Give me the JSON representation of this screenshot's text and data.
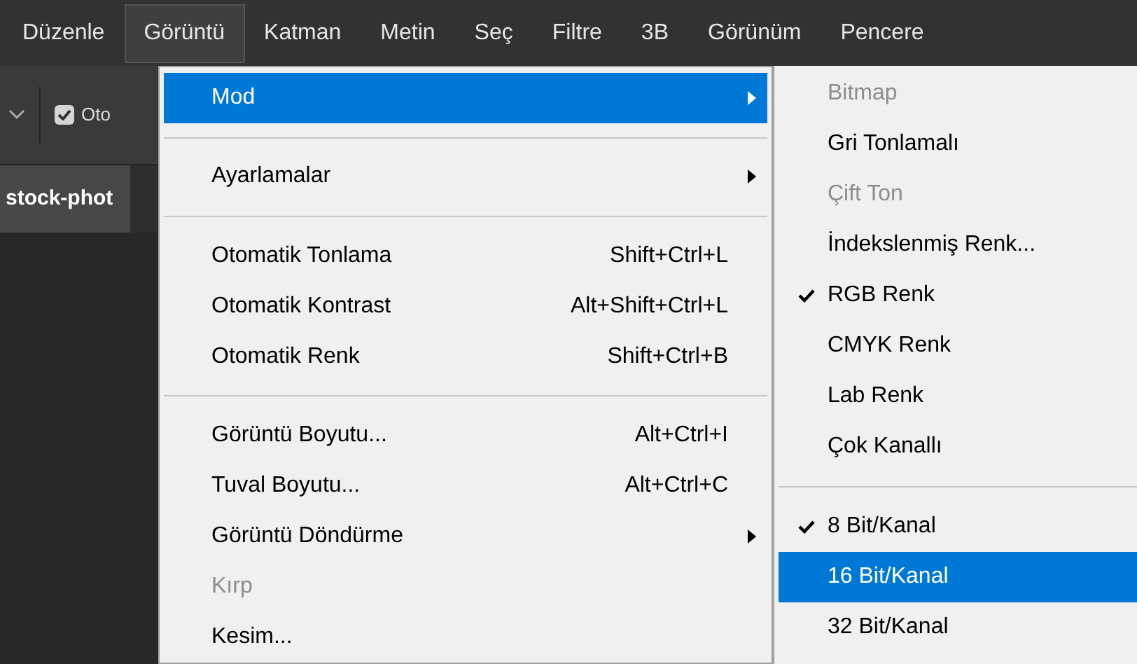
{
  "menubar": [
    {
      "label": "Düzenle",
      "selected": false
    },
    {
      "label": "Görüntü",
      "selected": true
    },
    {
      "label": "Katman",
      "selected": false
    },
    {
      "label": "Metin",
      "selected": false
    },
    {
      "label": "Seç",
      "selected": false
    },
    {
      "label": "Filtre",
      "selected": false
    },
    {
      "label": "3B",
      "selected": false
    },
    {
      "label": "Görünüm",
      "selected": false
    },
    {
      "label": "Pencere",
      "selected": false
    }
  ],
  "options_bar": {
    "checkbox": {
      "label": "Oto",
      "checked": true
    }
  },
  "document_tab": {
    "label": "stock-phot"
  },
  "menu": [
    {
      "kind": "item",
      "label": "Mod",
      "submenu": true,
      "selected": true,
      "disabled": false
    },
    {
      "kind": "separator"
    },
    {
      "kind": "item",
      "label": "Ayarlamalar",
      "submenu": true,
      "selected": false,
      "disabled": false
    },
    {
      "kind": "separator"
    },
    {
      "kind": "item",
      "label": "Otomatik Tonlama",
      "shortcut": "Shift+Ctrl+L",
      "submenu": false,
      "selected": false,
      "disabled": false
    },
    {
      "kind": "item",
      "label": "Otomatik Kontrast",
      "shortcut": "Alt+Shift+Ctrl+L",
      "submenu": false,
      "selected": false,
      "disabled": false
    },
    {
      "kind": "item",
      "label": "Otomatik Renk",
      "shortcut": "Shift+Ctrl+B",
      "submenu": false,
      "selected": false,
      "disabled": false
    },
    {
      "kind": "separator"
    },
    {
      "kind": "item",
      "label": "Görüntü Boyutu...",
      "shortcut": "Alt+Ctrl+I",
      "submenu": false,
      "selected": false,
      "disabled": false
    },
    {
      "kind": "item",
      "label": "Tuval Boyutu...",
      "shortcut": "Alt+Ctrl+C",
      "submenu": false,
      "selected": false,
      "disabled": false
    },
    {
      "kind": "item",
      "label": "Görüntü Döndürme",
      "submenu": true,
      "selected": false,
      "disabled": false
    },
    {
      "kind": "item",
      "label": "Kırp",
      "submenu": false,
      "selected": false,
      "disabled": true
    },
    {
      "kind": "item",
      "label": "Kesim...",
      "submenu": false,
      "selected": false,
      "disabled": false
    }
  ],
  "submenu": [
    {
      "kind": "item",
      "label": "Bitmap",
      "checked": false,
      "selected": false,
      "disabled": true
    },
    {
      "kind": "item",
      "label": "Gri Tonlamalı",
      "checked": false,
      "selected": false,
      "disabled": false
    },
    {
      "kind": "item",
      "label": "Çift Ton",
      "checked": false,
      "selected": false,
      "disabled": true
    },
    {
      "kind": "item",
      "label": "İndekslenmiş Renk...",
      "checked": false,
      "selected": false,
      "disabled": false
    },
    {
      "kind": "item",
      "label": "RGB Renk",
      "checked": true,
      "selected": false,
      "disabled": false
    },
    {
      "kind": "item",
      "label": "CMYK Renk",
      "checked": false,
      "selected": false,
      "disabled": false
    },
    {
      "kind": "item",
      "label": "Lab Renk",
      "checked": false,
      "selected": false,
      "disabled": false
    },
    {
      "kind": "item",
      "label": "Çok Kanallı",
      "checked": false,
      "selected": false,
      "disabled": false
    },
    {
      "kind": "separator"
    },
    {
      "kind": "item",
      "label": "8 Bit/Kanal",
      "checked": true,
      "selected": false,
      "disabled": false
    },
    {
      "kind": "item",
      "label": "16 Bit/Kanal",
      "checked": false,
      "selected": true,
      "disabled": false
    },
    {
      "kind": "item",
      "label": "32 Bit/Kanal",
      "checked": false,
      "selected": false,
      "disabled": false
    }
  ]
}
